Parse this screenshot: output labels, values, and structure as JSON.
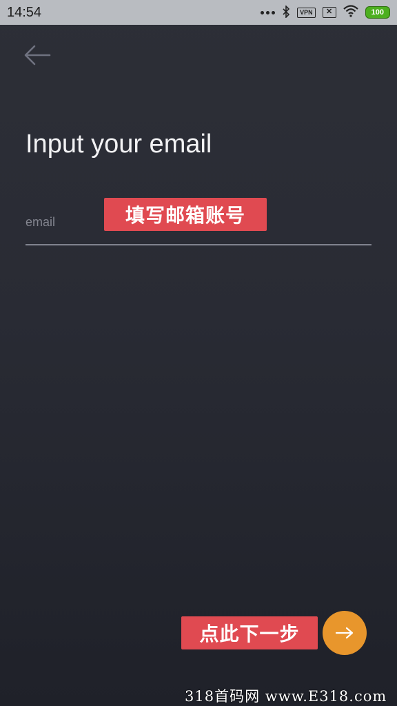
{
  "status_bar": {
    "time": "14:54",
    "vpn_label": "VPN",
    "battery_level": "100",
    "icons": [
      "more-dots-icon",
      "bluetooth-icon",
      "vpn-icon",
      "no-sim-icon",
      "wifi-icon",
      "battery-icon"
    ]
  },
  "nav": {
    "back_icon": "arrow-left-icon"
  },
  "main": {
    "title": "Input your email",
    "email_placeholder": "email",
    "email_value": ""
  },
  "annotations": {
    "email_hint": "填写邮箱账号",
    "next_hint": "点此下一步"
  },
  "next_button": {
    "icon": "arrow-right-icon"
  },
  "watermark": "318首码网 www.E318.com",
  "colors": {
    "background": "#2a2c35",
    "accent": "#e8962c",
    "annotation": "#e04a51",
    "battery": "#4caf1f"
  }
}
